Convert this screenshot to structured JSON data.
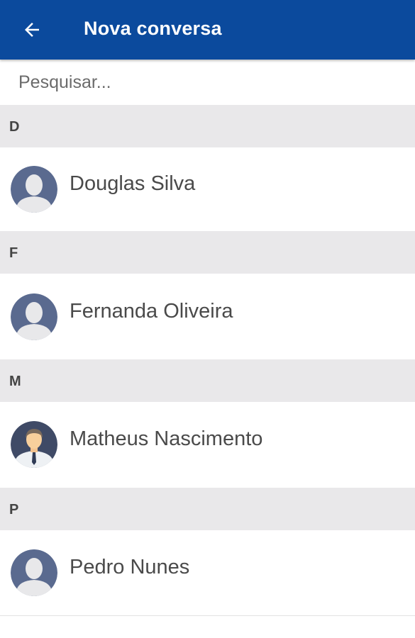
{
  "appbar": {
    "title": "Nova conversa",
    "back_icon": "arrow-left-icon",
    "color": "#0b4a9d"
  },
  "search": {
    "placeholder": "Pesquisar...",
    "value": ""
  },
  "sections": [
    {
      "letter": "D",
      "contacts": [
        {
          "name": "Douglas Silva",
          "avatar": "default-person-avatar"
        }
      ]
    },
    {
      "letter": "F",
      "contacts": [
        {
          "name": "Fernanda Oliveira",
          "avatar": "default-person-avatar"
        }
      ]
    },
    {
      "letter": "M",
      "contacts": [
        {
          "name": "Matheus Nascimento",
          "avatar": "businessman-avatar"
        }
      ]
    },
    {
      "letter": "P",
      "contacts": [
        {
          "name": "Pedro Nunes",
          "avatar": "default-person-avatar"
        }
      ]
    }
  ],
  "colors": {
    "section_background": "#e9e8ea",
    "avatar_color": "#5a6a8f"
  }
}
